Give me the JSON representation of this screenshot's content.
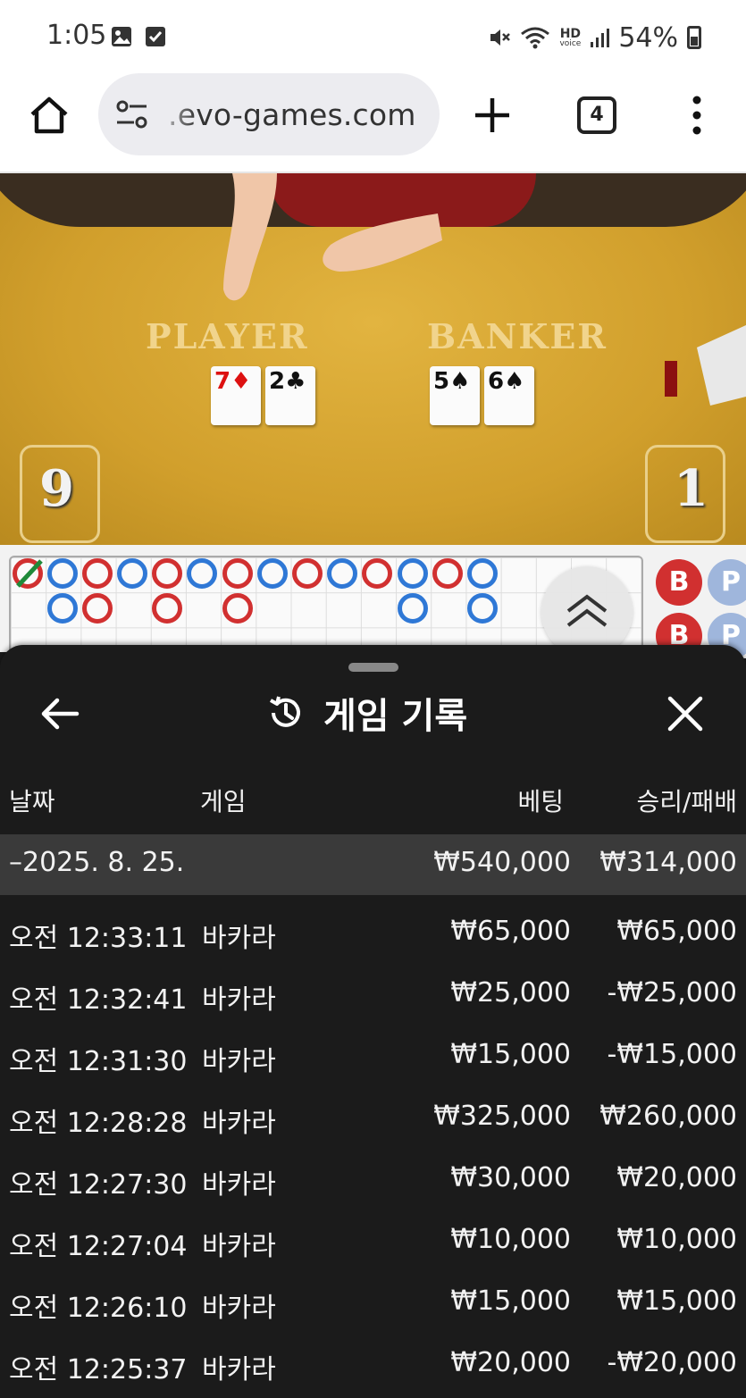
{
  "status_bar": {
    "time": "1:05",
    "battery": "54%",
    "icons": [
      "gallery-icon",
      "check-icon",
      "mute-icon",
      "wifi-icon",
      "hd-voice-icon",
      "signal-icon",
      "battery-icon"
    ],
    "hd_label": "HD",
    "voice_label": "voice"
  },
  "browser": {
    "url": ".evo-games.com",
    "tab_count": "4"
  },
  "game": {
    "player_label": "PLAYER",
    "banker_label": "BANKER",
    "player_score": "9",
    "banker_score": "1",
    "player_cards": [
      {
        "rank": "7",
        "suit": "♦",
        "color": "red"
      },
      {
        "rank": "2",
        "suit": "♣",
        "color": "black"
      }
    ],
    "banker_cards": [
      {
        "rank": "5",
        "suit": "♠",
        "color": "black"
      },
      {
        "rank": "6",
        "suit": "♠",
        "color": "black"
      }
    ]
  },
  "roadmap": {
    "predict_banker": "B",
    "predict_player": "P"
  },
  "history": {
    "title": "게임 기록",
    "columns": {
      "date": "날짜",
      "game": "게임",
      "bet": "베팅",
      "result": "승리/패배"
    },
    "summary": {
      "date": "–2025. 8. 25.",
      "bet": "₩540,000",
      "result": "₩314,000"
    },
    "rows": [
      {
        "time": "오전 12:33:11",
        "game": "바카라",
        "bet": "₩65,000",
        "result": "₩65,000"
      },
      {
        "time": "오전 12:32:41",
        "game": "바카라",
        "bet": "₩25,000",
        "result": "-₩25,000"
      },
      {
        "time": "오전 12:31:30",
        "game": "바카라",
        "bet": "₩15,000",
        "result": "-₩15,000"
      },
      {
        "time": "오전 12:28:28",
        "game": "바카라",
        "bet": "₩325,000",
        "result": "₩260,000"
      },
      {
        "time": "오전 12:27:30",
        "game": "바카라",
        "bet": "₩30,000",
        "result": "₩20,000"
      },
      {
        "time": "오전 12:27:04",
        "game": "바카라",
        "bet": "₩10,000",
        "result": "₩10,000"
      },
      {
        "time": "오전 12:26:10",
        "game": "바카라",
        "bet": "₩15,000",
        "result": "₩15,000"
      },
      {
        "time": "오전 12:25:37",
        "game": "바카라",
        "bet": "₩20,000",
        "result": "-₩20,000"
      }
    ]
  },
  "colors": {
    "banker_red": "#d13030",
    "player_blue": "#2f78d6",
    "panel_bg": "#1b1b1b",
    "summary_bg": "#3a3a3a",
    "felt": "#d4a535"
  }
}
